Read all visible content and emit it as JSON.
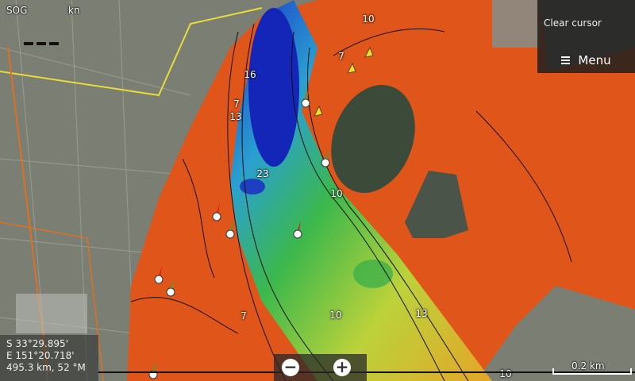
{
  "top_left": {
    "sog_label": "SOG",
    "unit_label": "kn"
  },
  "panel": {
    "clear_cursor_label": "Clear cursor",
    "menu_label": "Menu"
  },
  "cursor_readout": {
    "latitude": "S  33°29.895'",
    "longitude": "E 151°20.718'",
    "range_bearing": "495.3 km, 52 °M"
  },
  "zoom": {
    "zoom_out_symbol": "−",
    "zoom_in_symbol": "+"
  },
  "scale": {
    "label": "0.2 km"
  },
  "depth_labels": [
    "10",
    "7",
    "16",
    "7",
    "13",
    "23",
    "10",
    "7",
    "10",
    "13",
    "10"
  ],
  "colors": {
    "shallow": "#e0561a",
    "mid": "#d4c22a",
    "green": "#3db04a",
    "deep": "#1426b8"
  },
  "icons": [
    "hamburger-menu-icon",
    "zoom-out-icon",
    "zoom-in-icon",
    "green-channel-marker-icon",
    "red-channel-marker-icon",
    "yellow-marker-icon"
  ]
}
